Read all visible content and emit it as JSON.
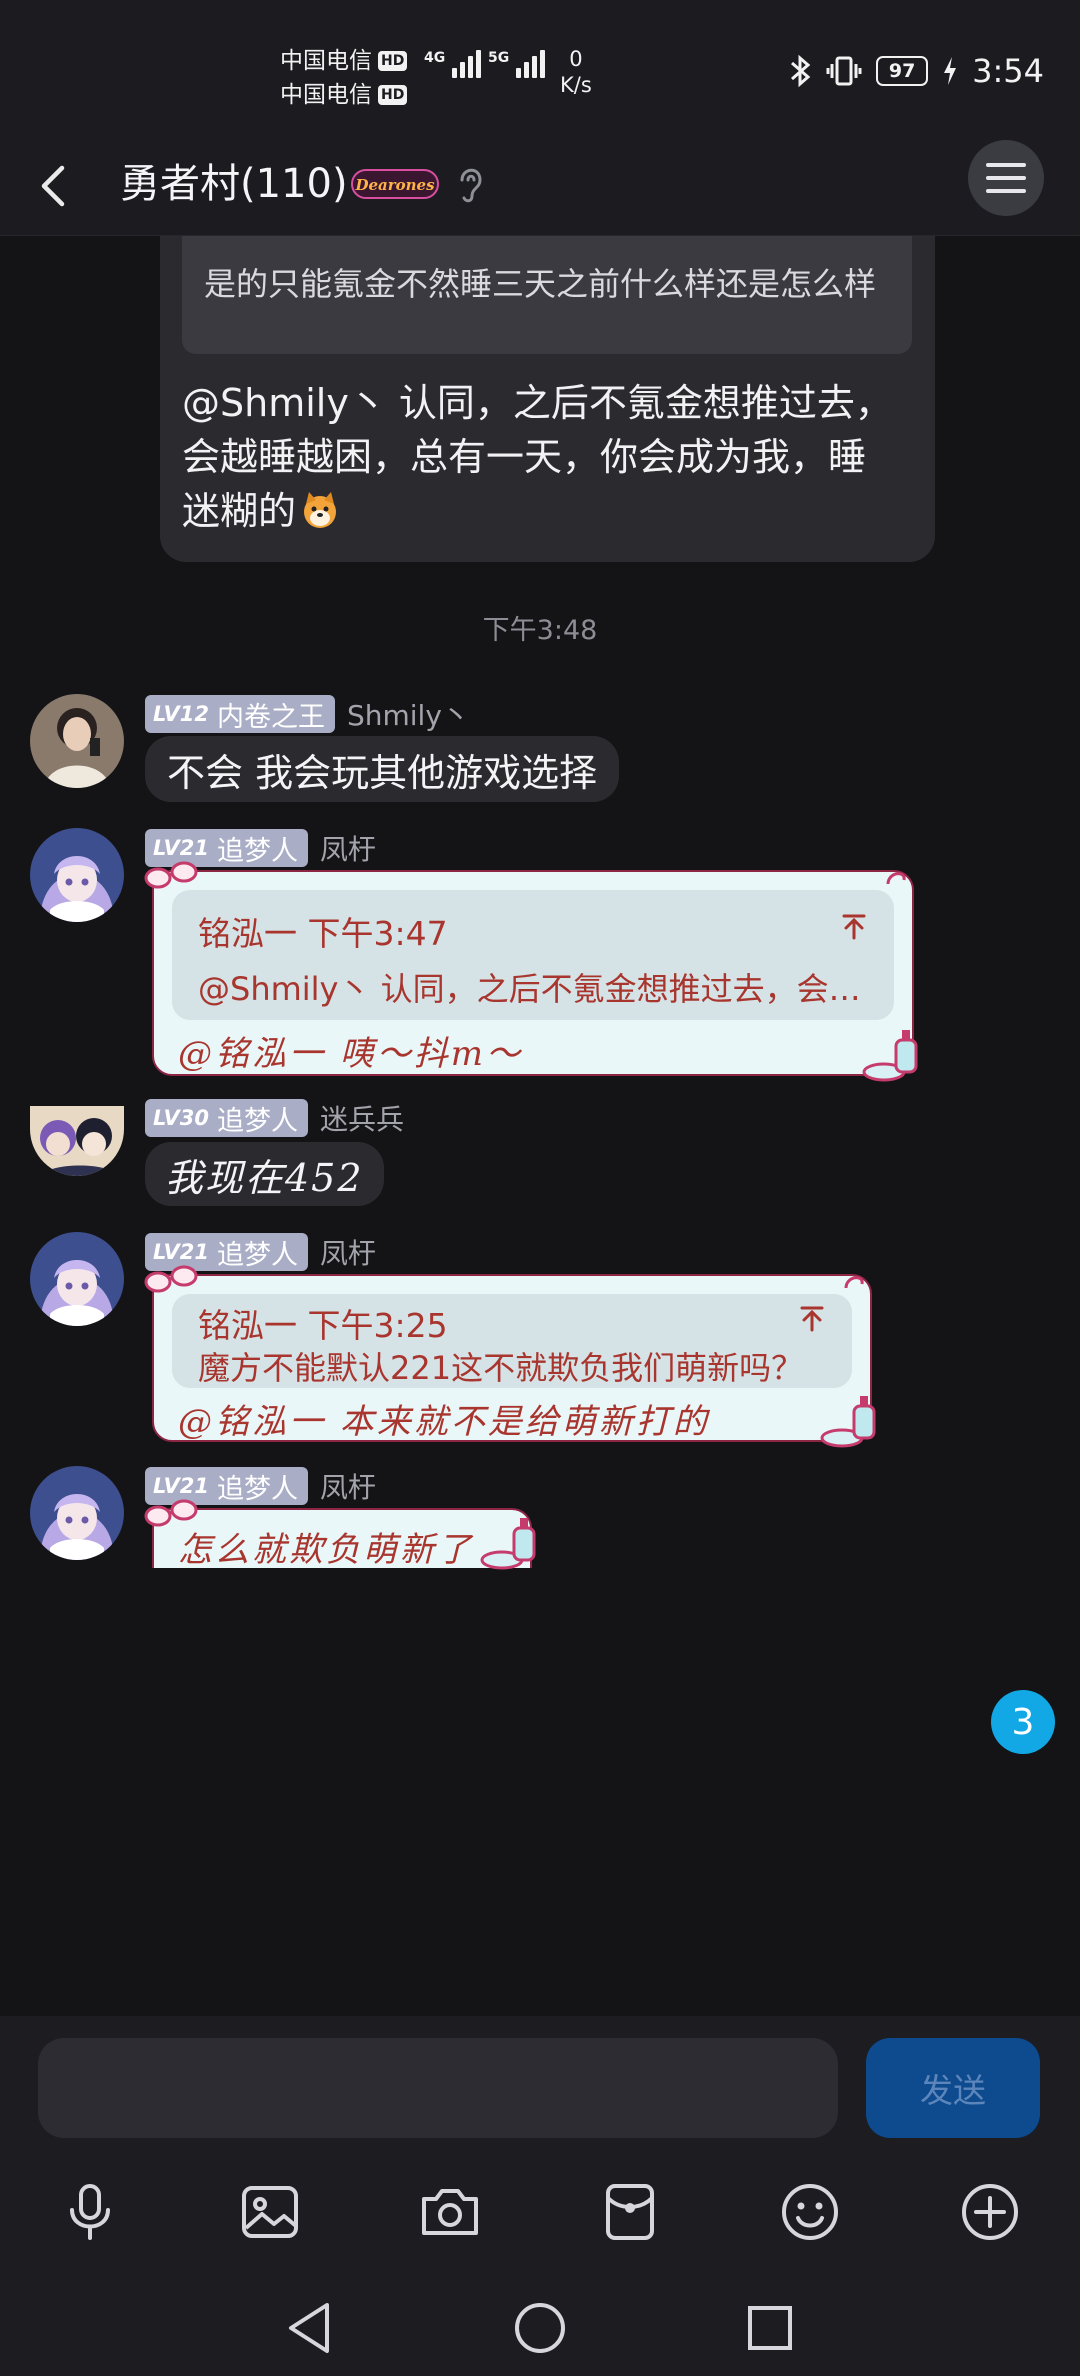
{
  "status_bar": {
    "carrier_1": "中国电信",
    "carrier_2": "中国电信",
    "hd": "HD",
    "net_1": "4G",
    "net_2": "5G",
    "speed_value": "0",
    "speed_unit": "K/s",
    "battery": "97",
    "time": "3:54"
  },
  "header": {
    "title": "勇者村(110)",
    "badge_text": "Dearones"
  },
  "messages": {
    "m0": {
      "quote_text": "是的只能氪金不然睡三天之前什么样还是怎么样",
      "text": "@Shmily丶 认同，之后不氪金想推过去，会越睡越困，总有一天，你会成为我，睡迷糊的"
    },
    "time_divider": "下午3:48",
    "m1": {
      "level": "LV12",
      "title": "内卷之王",
      "nickname": "Shmily丶",
      "text": "不会 我会玩其他游戏选择"
    },
    "m2": {
      "level": "LV21",
      "title": "追梦人",
      "nickname": "凤杅",
      "quote_author_time": "铭泓一 下午3:47",
      "quote_text": "@Shmily丶 认同，之后不氪金想推过去，会越睡越困，总有一天，你会成为我，睡迷糊...",
      "reply": "@铭泓一 咦～抖m～"
    },
    "m3": {
      "level": "LV30",
      "title": "追梦人",
      "nickname": "迷兵兵",
      "text": "我现在452"
    },
    "m4": {
      "level": "LV21",
      "title": "追梦人",
      "nickname": "凤杅",
      "quote_author_time": "铭泓一 下午3:25",
      "quote_text": "魔方不能默认221这不就欺负我们萌新吗？",
      "reply": "@铭泓一 本来就不是给萌新打的"
    },
    "m5": {
      "level": "LV21",
      "title": "追梦人",
      "nickname": "凤杅",
      "reply": "怎么就欺负萌新了"
    }
  },
  "unread_count": "3",
  "composer": {
    "input_value": "",
    "send_label": "发送"
  },
  "colors": {
    "background": "#141417",
    "bubble": "#2a2a2f",
    "theme_bubble": "#eaf7f8",
    "theme_text": "#a8352e",
    "accent_blue": "#12a8e6",
    "send_button": "#0d4a8e"
  },
  "icons": [
    "back-arrow-icon",
    "ear-icon",
    "menu-icon",
    "quote-jump-icon",
    "microphone-icon",
    "image-icon",
    "camera-icon",
    "red-packet-icon",
    "emoji-icon",
    "plus-icon",
    "nav-back-icon",
    "nav-home-icon",
    "nav-recents-icon"
  ]
}
